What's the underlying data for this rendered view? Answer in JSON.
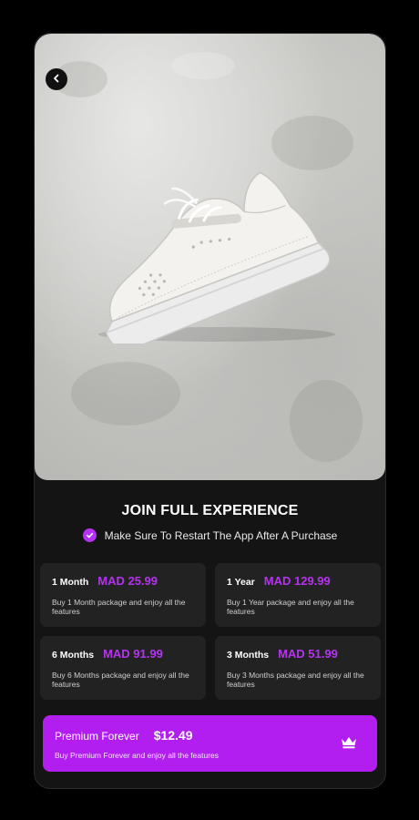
{
  "header": {
    "back_icon": "chevron-left-icon"
  },
  "main": {
    "title": "JOIN FULL EXPERIENCE",
    "note": "Make Sure To Restart The App After A Purchase",
    "note_icon": "check-circle-icon"
  },
  "plans": [
    {
      "period": "1 Month",
      "price": "MAD 25.99",
      "description": "Buy 1 Month package and enjoy all the features"
    },
    {
      "period": "1 Year",
      "price": "MAD 129.99",
      "description": "Buy 1 Year package and enjoy all the features"
    },
    {
      "period": "6 Months",
      "price": "MAD 91.99",
      "description": "Buy 6 Months package and enjoy all the features"
    },
    {
      "period": "3 Months",
      "price": "MAD 51.99",
      "description": "Buy 3 Months package and enjoy all the features"
    }
  ],
  "premium": {
    "period": "Premium Forever",
    "price": "$12.49",
    "description": "Buy Premium Forever and enjoy all the features",
    "icon": "crown-icon"
  },
  "colors": {
    "accent": "#b533f0",
    "premium_bg": "#b21ef0",
    "card_bg": "#222222",
    "screen_bg": "#141414"
  }
}
